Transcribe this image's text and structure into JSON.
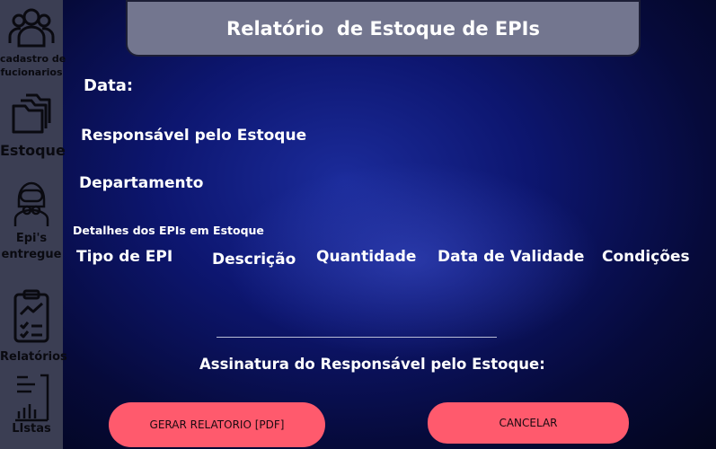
{
  "sidebar": {
    "items": [
      {
        "label_line1": "cadastro de",
        "label_line2": "fucionarios",
        "icon": "users-icon"
      },
      {
        "label": "Estoque",
        "icon": "folders-icon"
      },
      {
        "label_line1": "Epi's",
        "label_line2": "entregue",
        "icon": "hazmat-worker-icon"
      },
      {
        "label": "Relatórios",
        "icon": "clipboard-chart-icon"
      },
      {
        "label": "LIstas",
        "icon": "list-chart-icon"
      }
    ]
  },
  "header": {
    "title": "Relatório  de Estoque de EPIs"
  },
  "form": {
    "date_label": "Data:",
    "responsible_label": "Responsável pelo Estoque",
    "department_label": "Departamento",
    "details_heading": "Detalhes dos EPIs em Estoque",
    "columns": [
      "Tipo de EPI",
      "Descrição",
      "Quantidade",
      "Data de Validade",
      "Condições"
    ],
    "signature_label": "Assinatura do Responsável pelo Estoque:"
  },
  "actions": {
    "generate_label": "GERAR RELATORIO [PDF]",
    "cancel_label": "CANCELAR"
  },
  "colors": {
    "sidebar": "#3b3e53",
    "titlebar": "#73768f",
    "button": "#ff5a6d",
    "background": "#0d1670"
  }
}
